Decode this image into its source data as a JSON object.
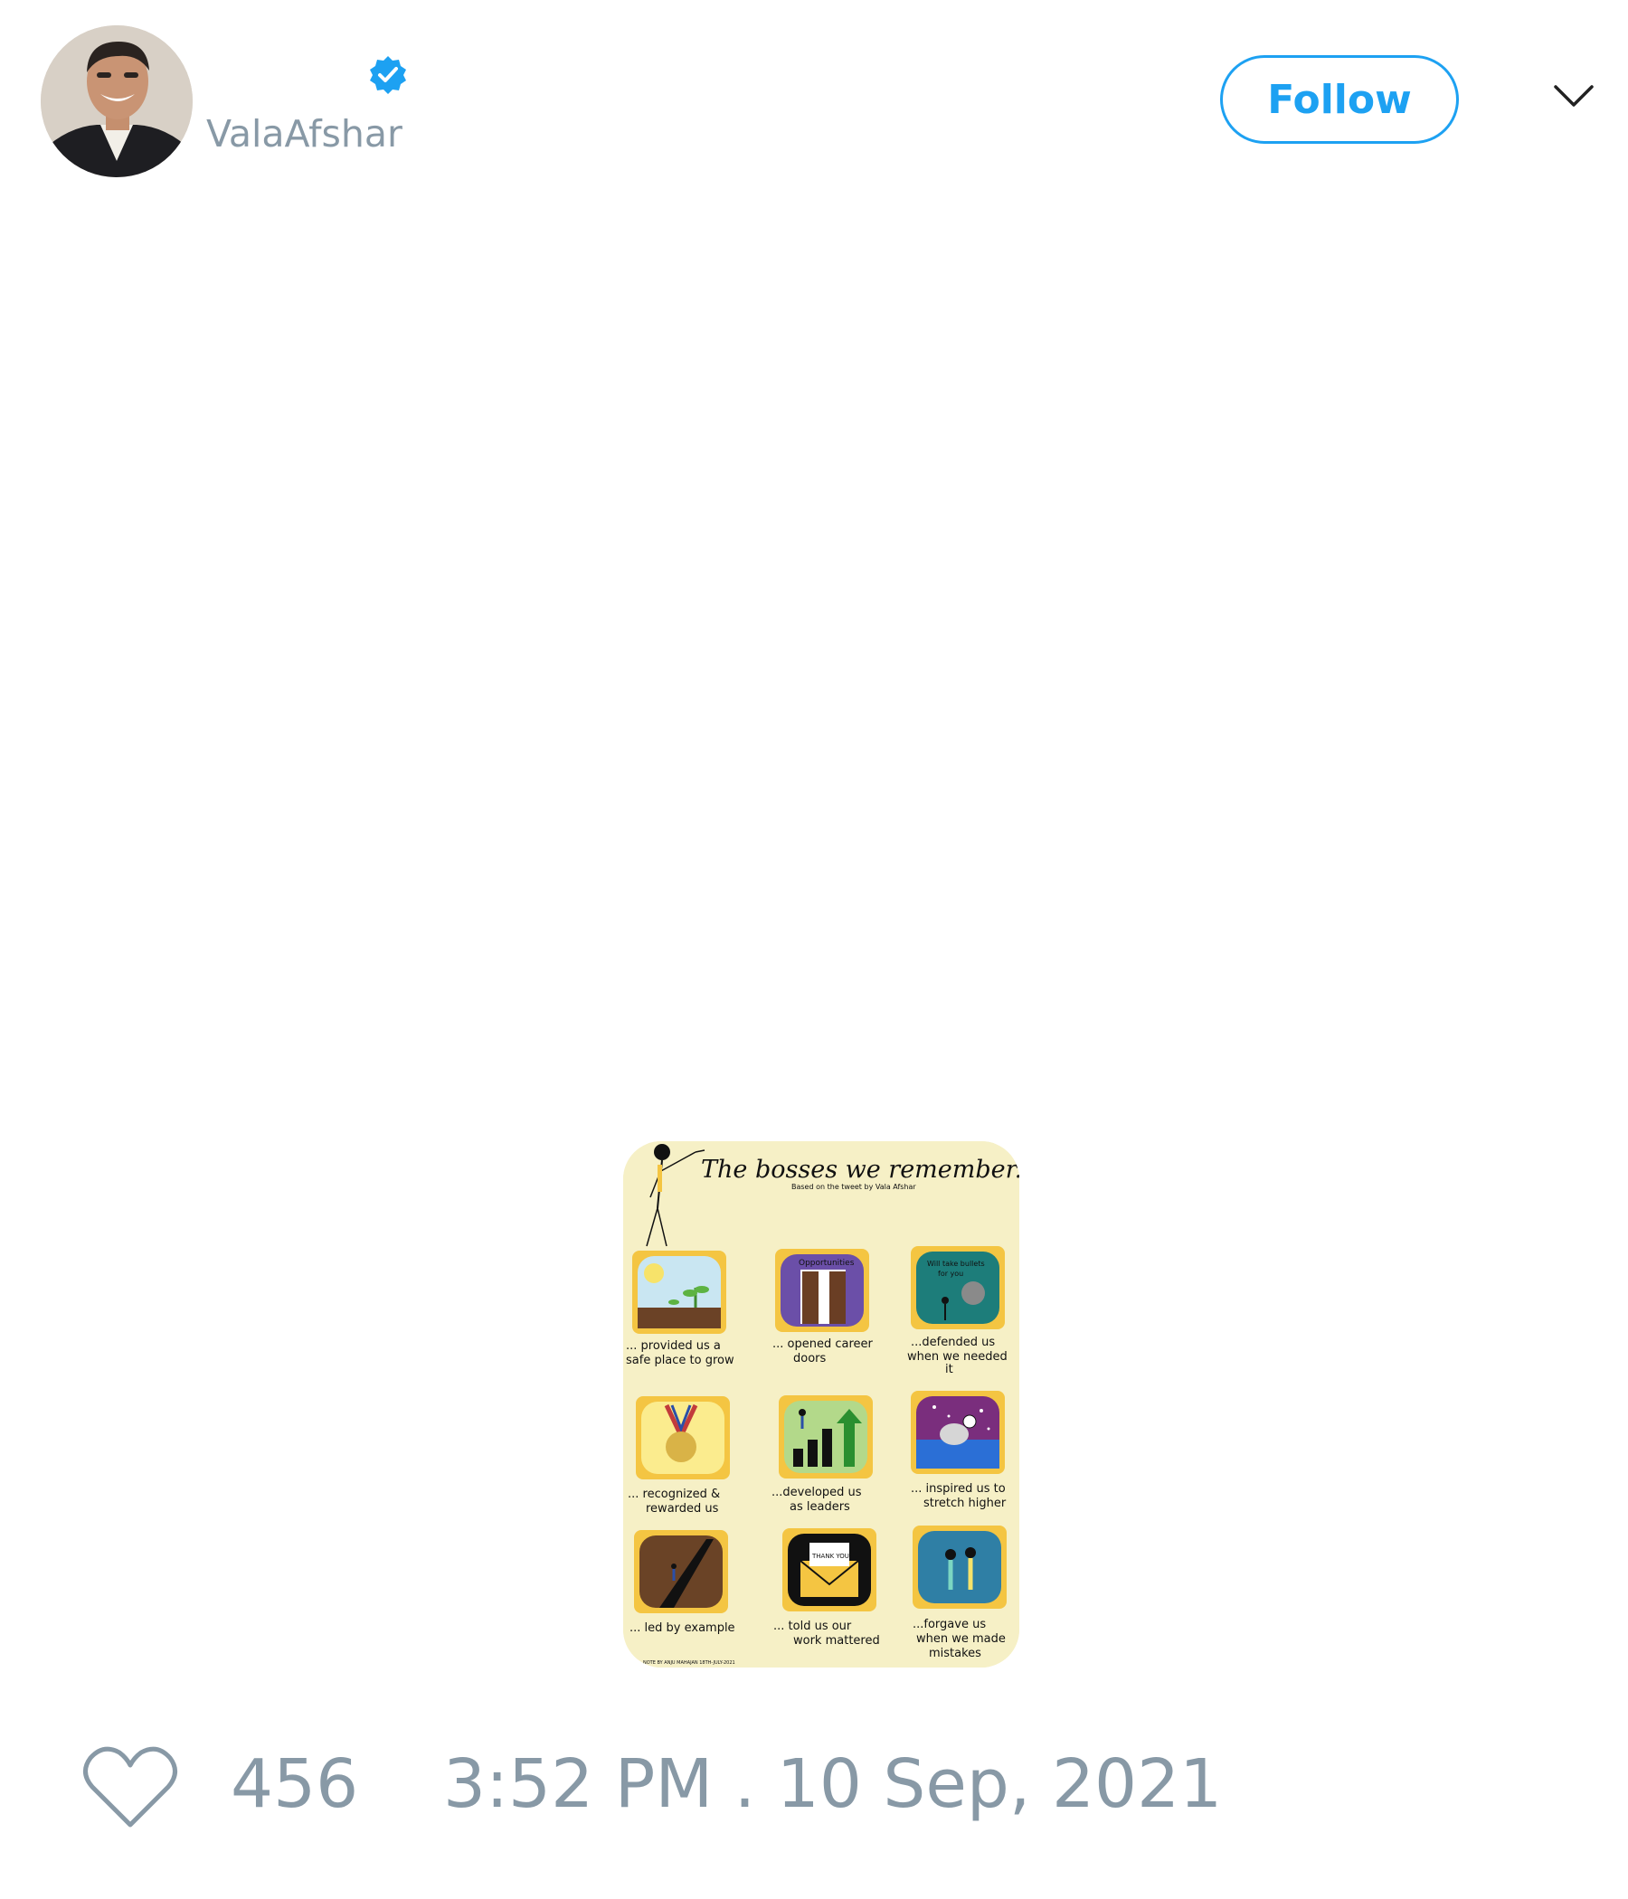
{
  "author": {
    "handle": "ValaAfshar",
    "verified": true,
    "avatar_icon": "person-photo"
  },
  "actions": {
    "follow_label": "Follow",
    "menu_icon": "chevron-down-icon"
  },
  "media": {
    "title": "The bosses we remember...",
    "subtitle": "Based on the tweet by Vala Afshar",
    "panels": [
      {
        "label_line1": "Will take bullets",
        "label_line2": "for you"
      },
      {
        "label": "Opportunities"
      }
    ],
    "captions": [
      [
        "... provided us a",
        "safe place to grow"
      ],
      [
        "... opened career",
        "doors"
      ],
      [
        "...defended us",
        "when we needed",
        "it"
      ],
      [
        "... recognized &",
        "rewarded us"
      ],
      [
        "...developed us",
        "as leaders"
      ],
      [
        "... inspired us to",
        "stretch higher"
      ],
      [
        "... led by example"
      ],
      [
        "... told us our",
        "work mattered"
      ],
      [
        "...forgave us",
        "when we made",
        "mistakes"
      ]
    ],
    "thank_you": "THANK YOU",
    "credit": "NOTE BY ANJU MAHAJAN 18TH-JULY-2021"
  },
  "engagement": {
    "like_icon": "heart-icon",
    "like_count": "456",
    "timestamp": "3:52 PM . 10 Sep, 2021"
  },
  "colors": {
    "accent": "#1da1f2",
    "muted_text": "#8899a6",
    "poster_background": "#f6f0c6",
    "panel_frame": "#f4c542"
  }
}
